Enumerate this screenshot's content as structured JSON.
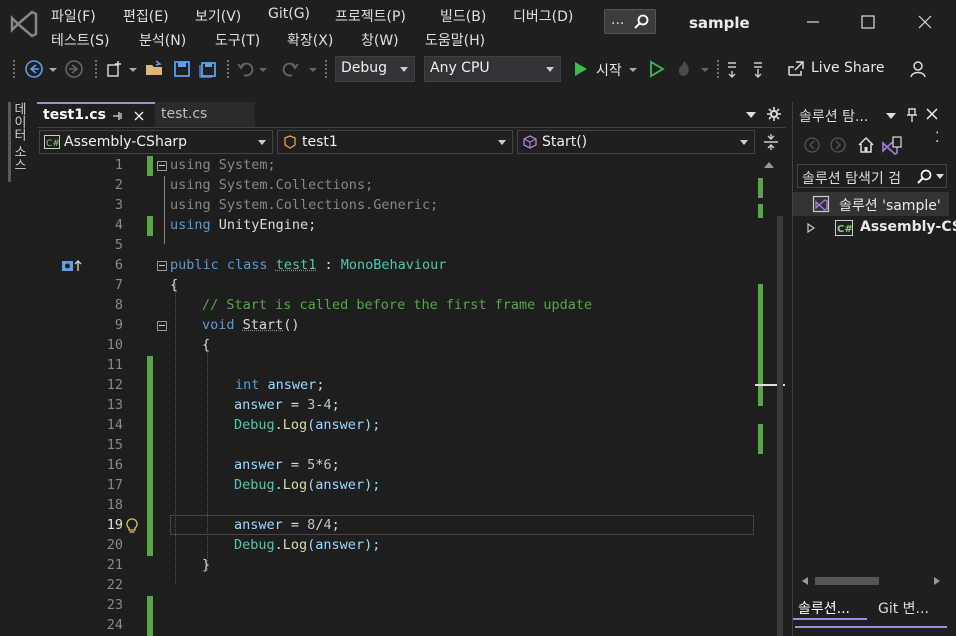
{
  "app": {
    "window_title": "sample"
  },
  "menu": {
    "row1": [
      "파일(F)",
      "편집(E)",
      "보기(V)",
      "Git(G)",
      "프로젝트(P)",
      "빌드(B)",
      "디버그(D)"
    ],
    "row2": [
      "테스트(S)",
      "분석(N)",
      "도구(T)",
      "확장(X)",
      "창(W)",
      "도움말(H)"
    ],
    "search_label": "..."
  },
  "toolbar": {
    "config": "Debug",
    "platform": "Any CPU",
    "start_label": "시작",
    "live_share_label": "Live Share"
  },
  "left_strip": {
    "tab_label": "데이터 소스"
  },
  "editor": {
    "tabs": [
      {
        "label": "test1.cs"
      },
      {
        "label": "test.cs"
      }
    ],
    "nav": {
      "project": "Assembly-CSharp",
      "type": "test1",
      "member": "Start()"
    },
    "current_line": 19,
    "lines": [
      {
        "n": "1"
      },
      {
        "n": "2"
      },
      {
        "n": "3"
      },
      {
        "n": "4"
      },
      {
        "n": "5"
      },
      {
        "n": "6"
      },
      {
        "n": "7"
      },
      {
        "n": "8"
      },
      {
        "n": "9"
      },
      {
        "n": "10"
      },
      {
        "n": "11"
      },
      {
        "n": "12"
      },
      {
        "n": "13"
      },
      {
        "n": "14"
      },
      {
        "n": "15"
      },
      {
        "n": "16"
      },
      {
        "n": "17"
      },
      {
        "n": "18"
      },
      {
        "n": "19"
      },
      {
        "n": "20"
      },
      {
        "n": "21"
      },
      {
        "n": "22"
      },
      {
        "n": "23"
      },
      {
        "n": "24"
      }
    ],
    "code": {
      "l1": {
        "kw": "using",
        "rest": " System;"
      },
      "l2": {
        "kw": "using",
        "rest": " System.Collections;"
      },
      "l3": {
        "kw": "using",
        "rest": " System.Collections.Generic;"
      },
      "l4": {
        "kw": "using",
        "rest": " UnityEngine;"
      },
      "l6": {
        "kw1": "public",
        "kw2": "class",
        "name": "test1",
        "colon": " : ",
        "base": "MonoBehaviour"
      },
      "l7": {
        "text": "{"
      },
      "l8": {
        "comment": "// Start is called before the first frame update"
      },
      "l9": {
        "kw": "void",
        "method": "Start",
        "paren": "()"
      },
      "l10": {
        "text": "{"
      },
      "l12": {
        "kw": "int",
        "var": "answer",
        "end": ";"
      },
      "l13": {
        "var": "answer",
        "op": " = ",
        "n1": "3",
        "minus": "-",
        "n2": "4",
        "end": ";"
      },
      "l14": {
        "cls": "Debug",
        "dot": ".",
        "m": "Log",
        "arg": "(answer);"
      },
      "l16": {
        "var": "answer",
        "op": " = ",
        "n1": "5",
        "mul": "*",
        "n2": "6",
        "end": ";"
      },
      "l17": {
        "cls": "Debug",
        "dot": ".",
        "m": "Log",
        "arg": "(answer);"
      },
      "l19": {
        "var": "answer",
        "op": " = ",
        "n1": "8",
        "div": "/",
        "n2": "4",
        "end": ";"
      },
      "l20": {
        "cls": "Debug",
        "dot": ".",
        "m": "Log",
        "arg": "(answer);"
      },
      "l21": {
        "text": "}"
      }
    }
  },
  "solution_explorer": {
    "title": "솔루션 탐...",
    "search_placeholder": "솔루션 탐색기 검",
    "root_label": "솔루션 'sample'",
    "project_label": "Assembly-CS",
    "bottom_tabs": [
      "솔루션...",
      "Git 변..."
    ]
  },
  "colors": {
    "accent": "#9d8fe0",
    "change_bar": "#57a64a",
    "keyword": "#569cd6",
    "type": "#4ec9b0",
    "comment": "#57a64a"
  }
}
